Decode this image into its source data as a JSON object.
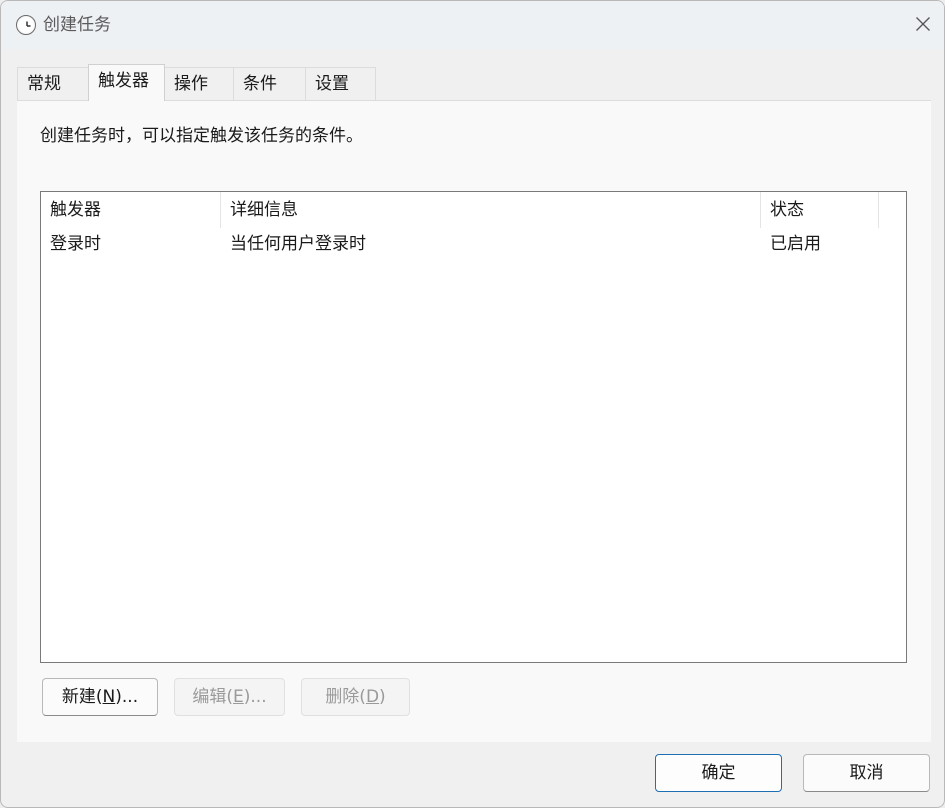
{
  "window": {
    "title": "创建任务",
    "icon": "clock-icon",
    "close_icon": "close-icon"
  },
  "tabs": [
    {
      "label": "常规",
      "active": false
    },
    {
      "label": "触发器",
      "active": true
    },
    {
      "label": "操作",
      "active": false
    },
    {
      "label": "条件",
      "active": false
    },
    {
      "label": "设置",
      "active": false
    }
  ],
  "panel": {
    "description": "创建任务时，可以指定触发该任务的条件。",
    "list": {
      "columns": [
        "触发器",
        "详细信息",
        "状态"
      ],
      "rows": [
        {
          "trigger": "登录时",
          "details": "当任何用户登录时",
          "status": "已启用"
        }
      ]
    },
    "buttons": {
      "new_main": "新建(",
      "new_mnemonic": "N",
      "new_tail": ")...",
      "edit_main": "编辑(",
      "edit_mnemonic": "E",
      "edit_tail": ")...",
      "delete_main": "删除(",
      "delete_mnemonic": "D",
      "delete_tail": ")"
    }
  },
  "footer": {
    "ok": "确定",
    "cancel": "取消"
  }
}
